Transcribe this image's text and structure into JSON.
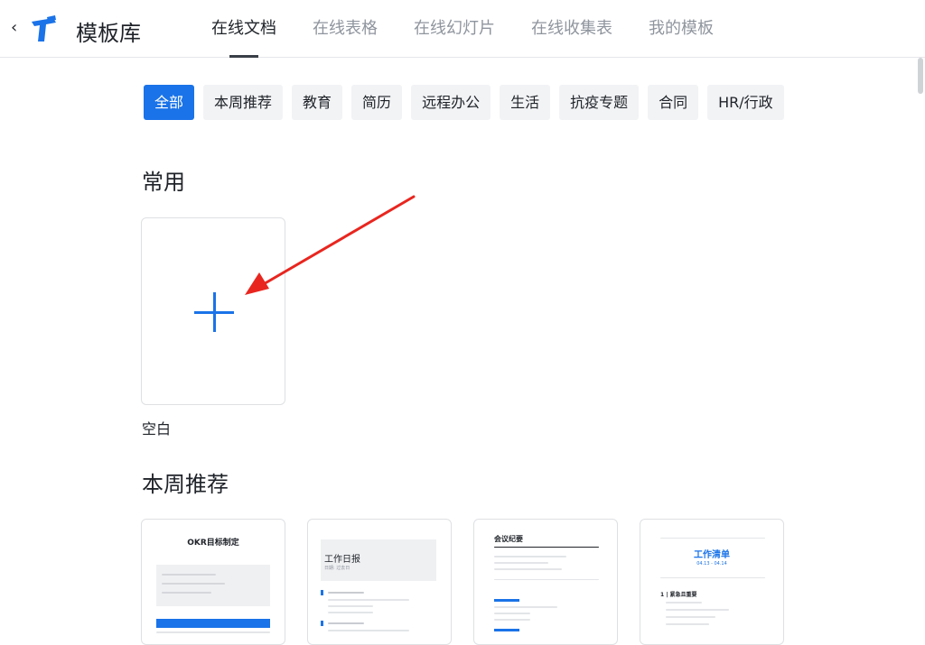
{
  "header": {
    "back_icon": "‹",
    "app_title": "模板库",
    "tabs": [
      {
        "label": "在线文档",
        "active": true
      },
      {
        "label": "在线表格",
        "active": false
      },
      {
        "label": "在线幻灯片",
        "active": false
      },
      {
        "label": "在线收集表",
        "active": false
      },
      {
        "label": "我的模板",
        "active": false
      }
    ]
  },
  "filters": [
    {
      "label": "全部",
      "active": true
    },
    {
      "label": "本周推荐"
    },
    {
      "label": "教育"
    },
    {
      "label": "简历"
    },
    {
      "label": "远程办公"
    },
    {
      "label": "生活"
    },
    {
      "label": "抗疫专题"
    },
    {
      "label": "合同"
    },
    {
      "label": "HR/行政"
    }
  ],
  "sections": {
    "common": {
      "title": "常用",
      "blank_label": "空白"
    },
    "weekly": {
      "title": "本周推荐",
      "templates": [
        {
          "title": "OKR目标制定"
        },
        {
          "title": "工作日报",
          "subtitle": "日期: 过去日"
        },
        {
          "title": "会议纪要"
        },
        {
          "title": "工作清单",
          "subtitle": "04.13 - 04.14",
          "section": "1 | 紧急且重要"
        }
      ]
    }
  },
  "colors": {
    "accent": "#1a73e8",
    "arrow": "#e8261f"
  }
}
